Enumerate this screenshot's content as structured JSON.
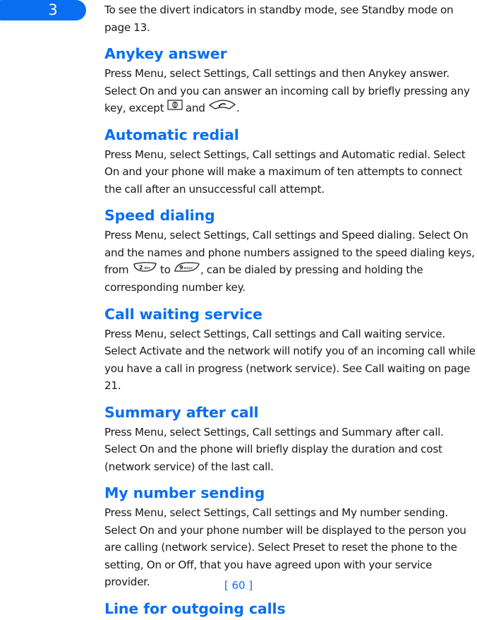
{
  "chapter": {
    "number": "3"
  },
  "intro": {
    "text": "To see the divert indicators in standby mode, see Standby mode on page 13."
  },
  "sections": [
    {
      "heading": "Anykey answer",
      "text_before": "Press Menu, select Settings, Call settings and then Anykey answer. Select On and you can answer an incoming call by briefly pressing any key, except ",
      "key1_icon": "power-key-icon",
      "joiner": " and ",
      "key2_icon": "end-call-key-icon",
      "text_after": "."
    },
    {
      "heading": "Automatic redial",
      "text": "Press Menu, select Settings, Call settings and Automatic redial. Select On and your phone will make a maximum of ten attempts to connect the call after an unsuccessful call attempt."
    },
    {
      "heading": "Speed dialing",
      "text_before": "Press Menu, select Settings, Call settings and Speed dialing. Select On and the names and phone numbers assigned to the speed dialing keys, from ",
      "key1_icon": "key-2-abc-icon",
      "key1_label": "2 abc",
      "joiner": " to ",
      "key2_icon": "key-9-wxyz-icon",
      "key2_label": "9wxyz",
      "text_after": ", can be dialed by pressing and holding the corresponding number key."
    },
    {
      "heading": "Call waiting service",
      "text": "Press Menu, select Settings, Call settings and Call waiting service. Select Activate and the network will notify you of an incoming call while you have a call in progress (network service). See Call waiting on page 21."
    },
    {
      "heading": "Summary after call",
      "text": "Press Menu, select Settings, Call settings and Summary after call. Select On and the phone will briefly display the duration and cost (network service) of the last call."
    },
    {
      "heading": "My number sending",
      "text": "Press Menu, select Settings, Call settings and My number sending. Select On and your phone number will be displayed to the person you are calling (network service). Select Preset to reset the phone to the setting, On or Off, that you have agreed upon with your service provider."
    },
    {
      "heading": "Line for outgoing calls"
    }
  ],
  "footer": {
    "page_number": "[ 60 ]"
  },
  "colors": {
    "accent": "#0a6ef0",
    "text": "#1a1a1a"
  }
}
